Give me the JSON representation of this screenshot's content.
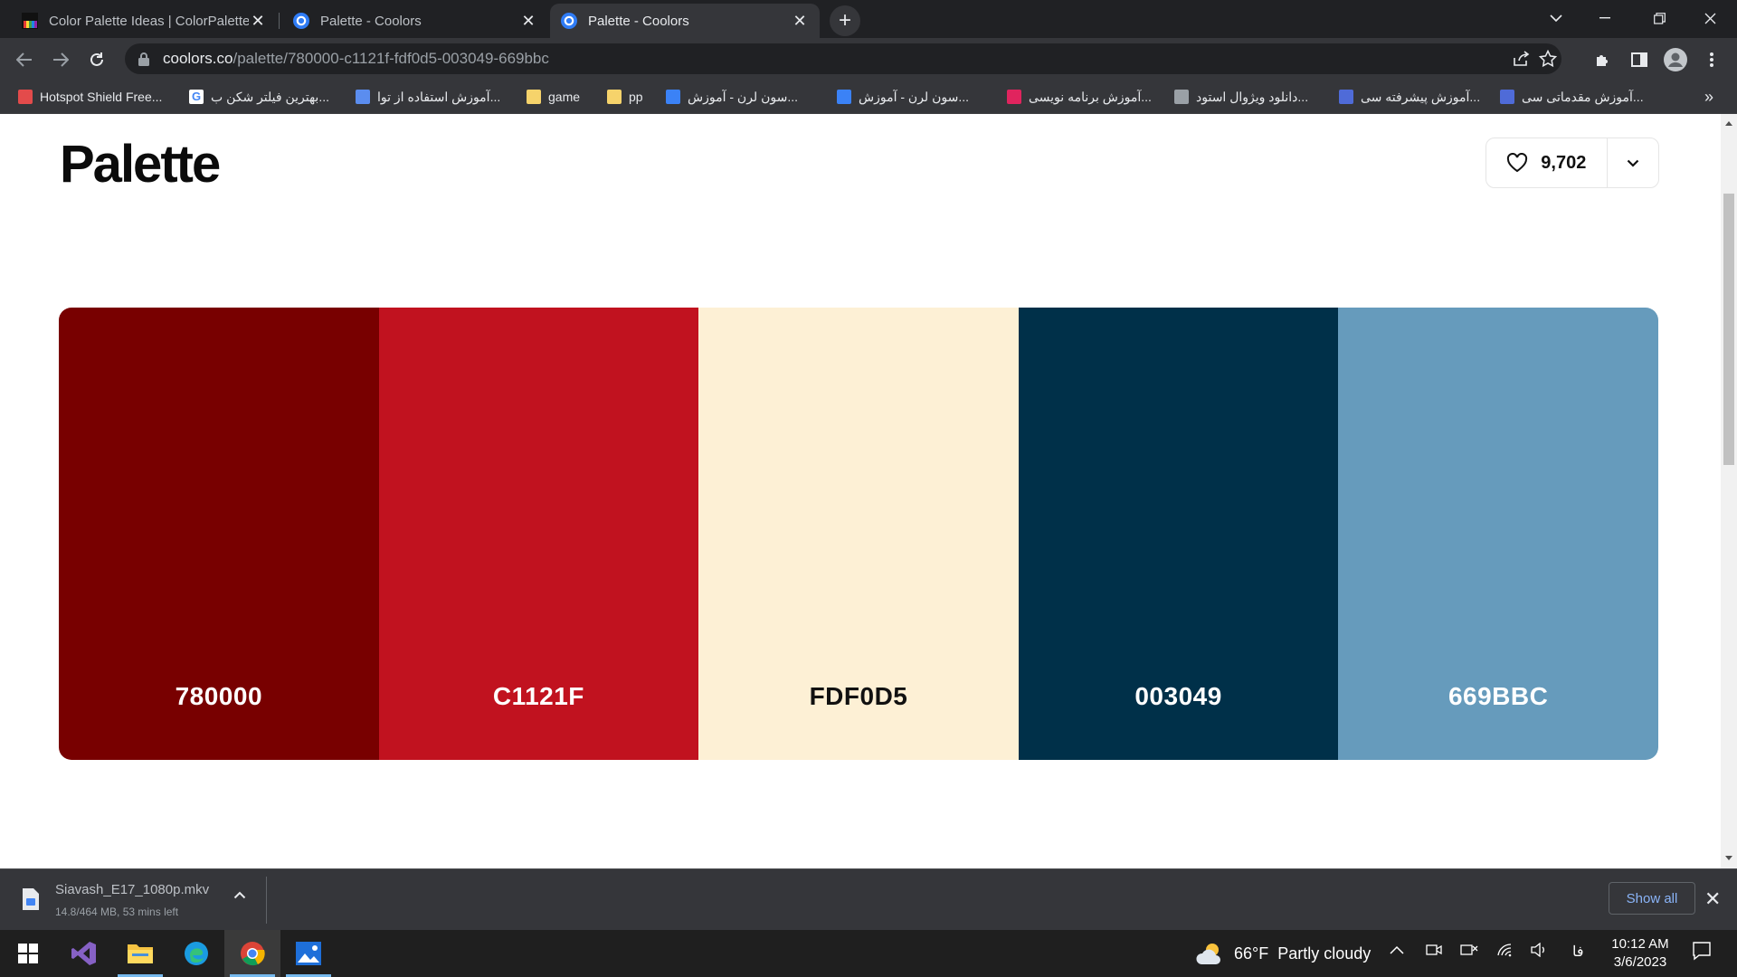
{
  "browser": {
    "tabs": [
      {
        "title": "Color Palette Ideas | ColorPalettes",
        "active": false
      },
      {
        "title": "Palette - Coolors",
        "active": false
      },
      {
        "title": "Palette - Coolors",
        "active": true
      }
    ],
    "address": {
      "host": "coolors.co",
      "path": "/palette/780000-c1121f-fdf0d5-003049-669bbc"
    },
    "bookmarks": [
      {
        "label": "Hotspot Shield Free...",
        "icon_color": "#e34b4b"
      },
      {
        "label": "بهترین فیلتر شکن ب...",
        "icon_color": "#ffffff"
      },
      {
        "label": "آموزش استفاده از توا...",
        "icon_color": "#5b8def"
      },
      {
        "label": "game",
        "icon_color": "#f6d36b"
      },
      {
        "label": "pp",
        "icon_color": "#f6d36b"
      },
      {
        "label": "سون لرن - آموزش...",
        "icon_color": "#3b82f6"
      },
      {
        "label": "سون لرن - آموزش...",
        "icon_color": "#3b82f6"
      },
      {
        "label": "آموزش برنامه نویسی...",
        "icon_color": "#e0245e"
      },
      {
        "label": "دانلود ویژوال استود...",
        "icon_color": "#9aa0a6"
      },
      {
        "label": "آموزش پیشرفته سی...",
        "icon_color": "#4f6bd8"
      },
      {
        "label": "آموزش مقدماتی سی...",
        "icon_color": "#4f6bd8"
      }
    ],
    "bookmarks_overflow": "»"
  },
  "page": {
    "title": "Palette",
    "likes": "9,702",
    "swatches": [
      {
        "hex": "780000",
        "color": "#780000",
        "text_color": "#ffffff"
      },
      {
        "hex": "C1121F",
        "color": "#c1121f",
        "text_color": "#ffffff"
      },
      {
        "hex": "FDF0D5",
        "color": "#fdf0d5",
        "text_color": "#111111"
      },
      {
        "hex": "003049",
        "color": "#003049",
        "text_color": "#ffffff"
      },
      {
        "hex": "669BBC",
        "color": "#669bbc",
        "text_color": "#ffffff"
      }
    ]
  },
  "download": {
    "filename": "Siavash_E17_1080p.mkv",
    "status": "14.8/464 MB, 53 mins left",
    "show_all": "Show all"
  },
  "taskbar": {
    "weather": {
      "temp": "66°F",
      "desc": "Partly cloudy"
    },
    "lang": "فا",
    "time": "10:12 AM",
    "date": "3/6/2023"
  }
}
